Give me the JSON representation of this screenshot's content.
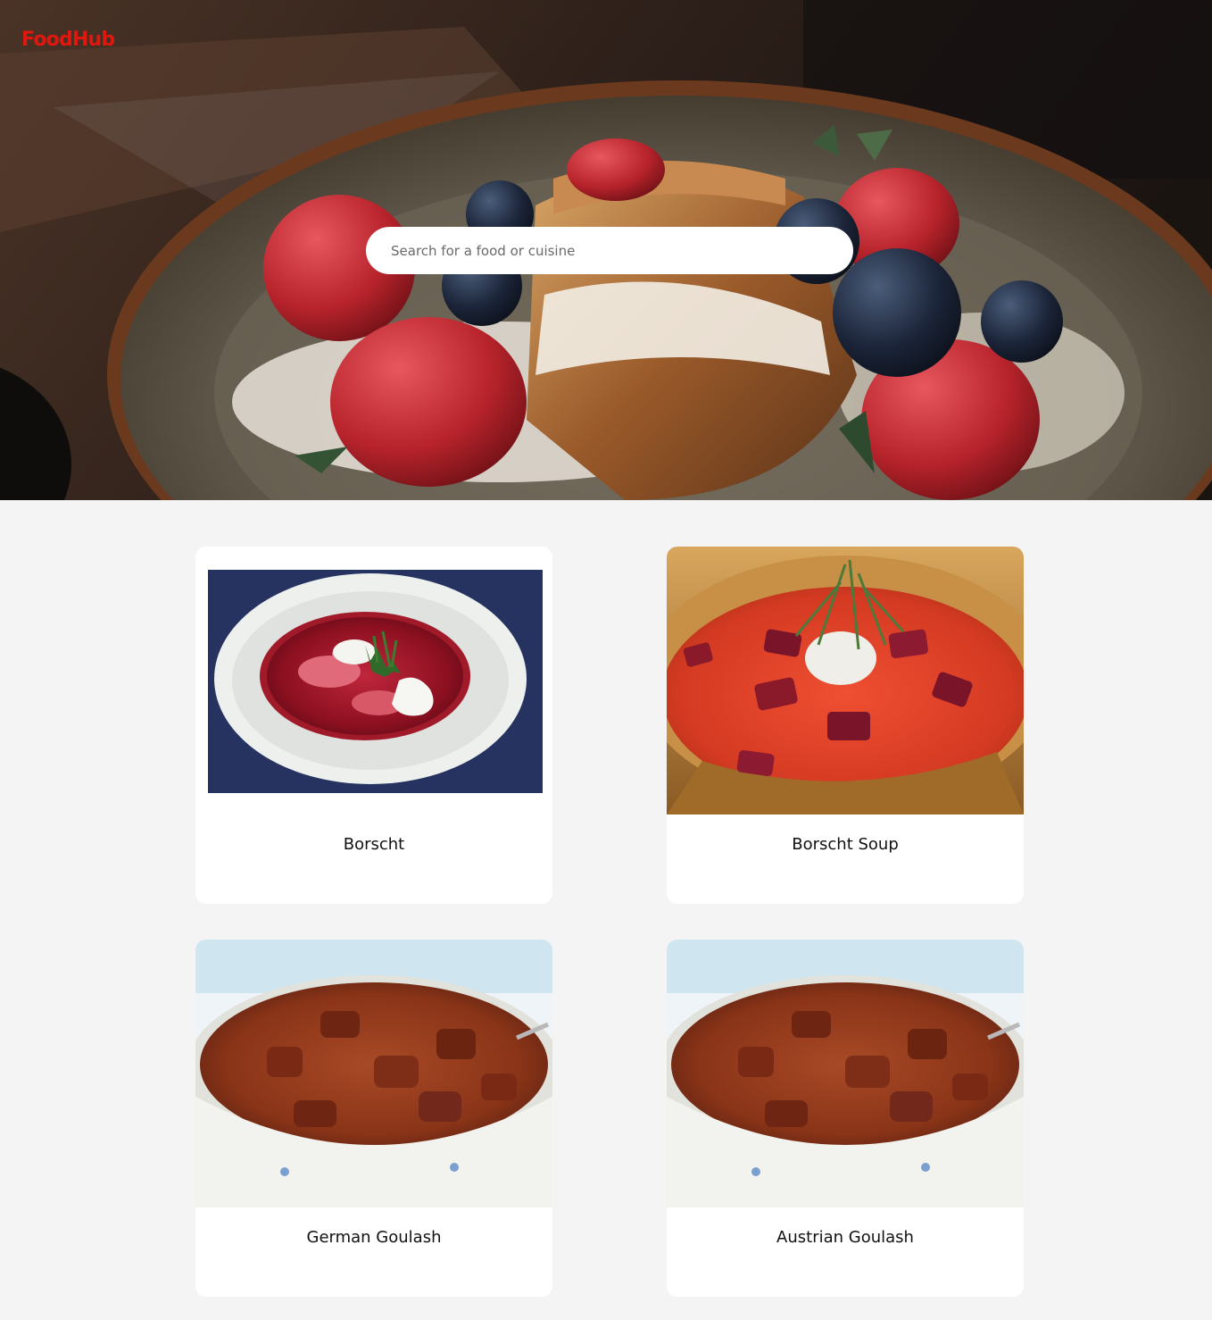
{
  "header": {
    "logo": "FoodHub"
  },
  "search": {
    "placeholder": "Search for a food or cuisine",
    "value": ""
  },
  "colors": {
    "brand": "#e0170f",
    "page_background": "#f4f4f4",
    "card_background": "#ffffff"
  },
  "results": [
    {
      "title": "Borscht",
      "image": "borscht-bowl-photo"
    },
    {
      "title": "Borscht Soup",
      "image": "borscht-soup-photo"
    },
    {
      "title": "German Goulash",
      "image": "goulash-bowl-photo"
    },
    {
      "title": "Austrian Goulash",
      "image": "goulash-bowl-photo"
    }
  ]
}
